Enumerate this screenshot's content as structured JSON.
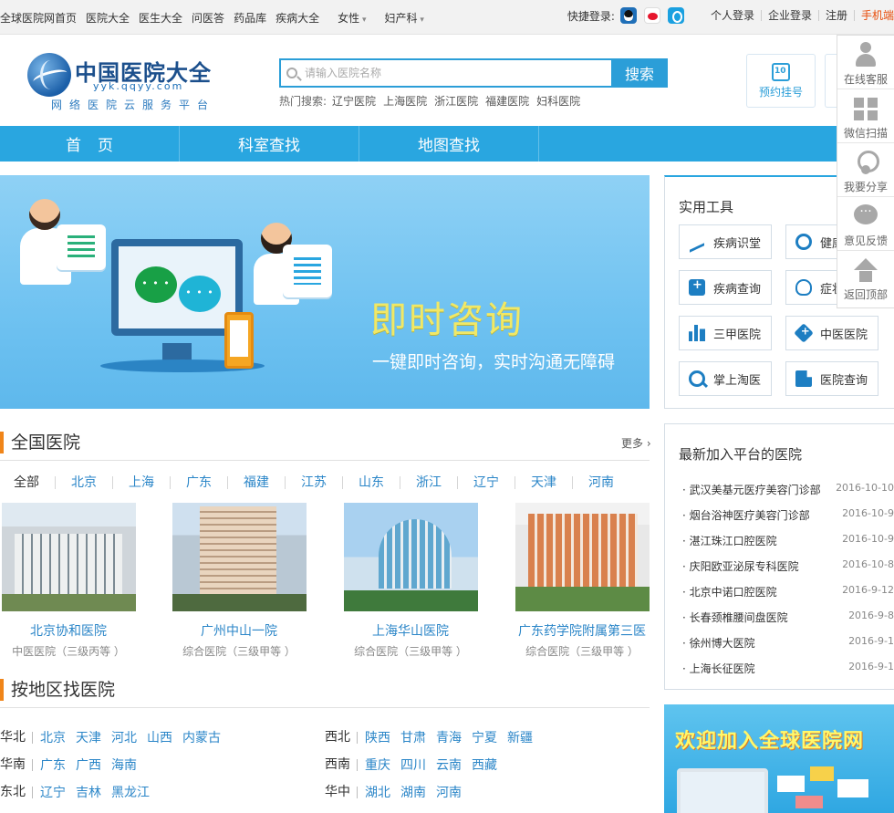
{
  "topbar": {
    "links": [
      "全球医院网首页",
      "医院大全",
      "医生大全",
      "问医答",
      "药品库",
      "疾病大全"
    ],
    "dropdowns": [
      "女性",
      "妇产科"
    ],
    "quick_login_label": "快捷登录:",
    "personal_login": "个人登录",
    "enterprise_login": "企业登录",
    "register": "注册",
    "mobile": "手机端"
  },
  "header": {
    "logo_title": "中国医院大全",
    "logo_domain": "yyk.qqyy.com",
    "logo_slogan": "网络医院云服务平台",
    "search_placeholder": "请输入医院名称",
    "search_button": "搜索",
    "hot_label": "热门搜索:",
    "hot_searches": [
      "辽宁医院",
      "上海医院",
      "浙江医院",
      "福建医院",
      "妇科医院"
    ],
    "appointment": "预约挂号"
  },
  "nav": {
    "items": [
      "首页",
      "科室查找",
      "地图查找"
    ]
  },
  "banner": {
    "title": "即时咨询",
    "subtitle": "一键即时咨询，实时沟通无障碍"
  },
  "tools": {
    "title": "实用工具",
    "items": [
      "疾病识堂",
      "健康",
      "疾病查询",
      "症状",
      "三甲医院",
      "中医医院",
      "掌上淘医",
      "医院查询"
    ]
  },
  "float_bar": {
    "items": [
      "在线客服",
      "微信扫描",
      "我要分享",
      "意见反馈",
      "返回顶部"
    ]
  },
  "hospitals": {
    "title": "全国医院",
    "more": "更多",
    "regions": [
      "全部",
      "北京",
      "上海",
      "广东",
      "福建",
      "江苏",
      "山东",
      "浙江",
      "辽宁",
      "天津",
      "河南"
    ],
    "cards": [
      {
        "name": "北京协和医院",
        "grade": "中医医院（三级丙等 ）"
      },
      {
        "name": "广州中山一院",
        "grade": "综合医院（三级甲等 ）"
      },
      {
        "name": "上海华山医院",
        "grade": "综合医院（三级甲等 ）"
      },
      {
        "name": "广东药学院附属第三医",
        "grade": "综合医院（三级甲等 ）"
      }
    ]
  },
  "by_region": {
    "title": "按地区找医院",
    "left": [
      {
        "label": "华北",
        "items": [
          "北京",
          "天津",
          "河北",
          "山西",
          "内蒙古"
        ]
      },
      {
        "label": "华南",
        "items": [
          "广东",
          "广西",
          "海南"
        ]
      },
      {
        "label": "东北",
        "items": [
          "辽宁",
          "吉林",
          "黑龙江"
        ]
      }
    ],
    "right": [
      {
        "label": "西北",
        "items": [
          "陕西",
          "甘肃",
          "青海",
          "宁夏",
          "新疆"
        ]
      },
      {
        "label": "西南",
        "items": [
          "重庆",
          "四川",
          "云南",
          "西藏"
        ]
      },
      {
        "label": "华中",
        "items": [
          "湖北",
          "湖南",
          "河南"
        ]
      }
    ]
  },
  "latest": {
    "title": "最新加入平台的医院",
    "rows": [
      {
        "name": "武汉美基元医疗美容门诊部",
        "date": "2016-10-10"
      },
      {
        "name": "烟台浴神医疗美容门诊部",
        "date": "2016-10-9"
      },
      {
        "name": "湛江珠江口腔医院",
        "date": "2016-10-9"
      },
      {
        "name": "庆阳欧亚泌尿专科医院",
        "date": "2016-10-8"
      },
      {
        "name": "北京中诺口腔医院",
        "date": "2016-9-12"
      },
      {
        "name": "长春颈椎腰间盘医院",
        "date": "2016-9-8"
      },
      {
        "name": "徐州博大医院",
        "date": "2016-9-1"
      },
      {
        "name": "上海长征医院",
        "date": "2016-9-1"
      }
    ]
  },
  "join_banner": {
    "title": "欢迎加入全球医院网"
  }
}
